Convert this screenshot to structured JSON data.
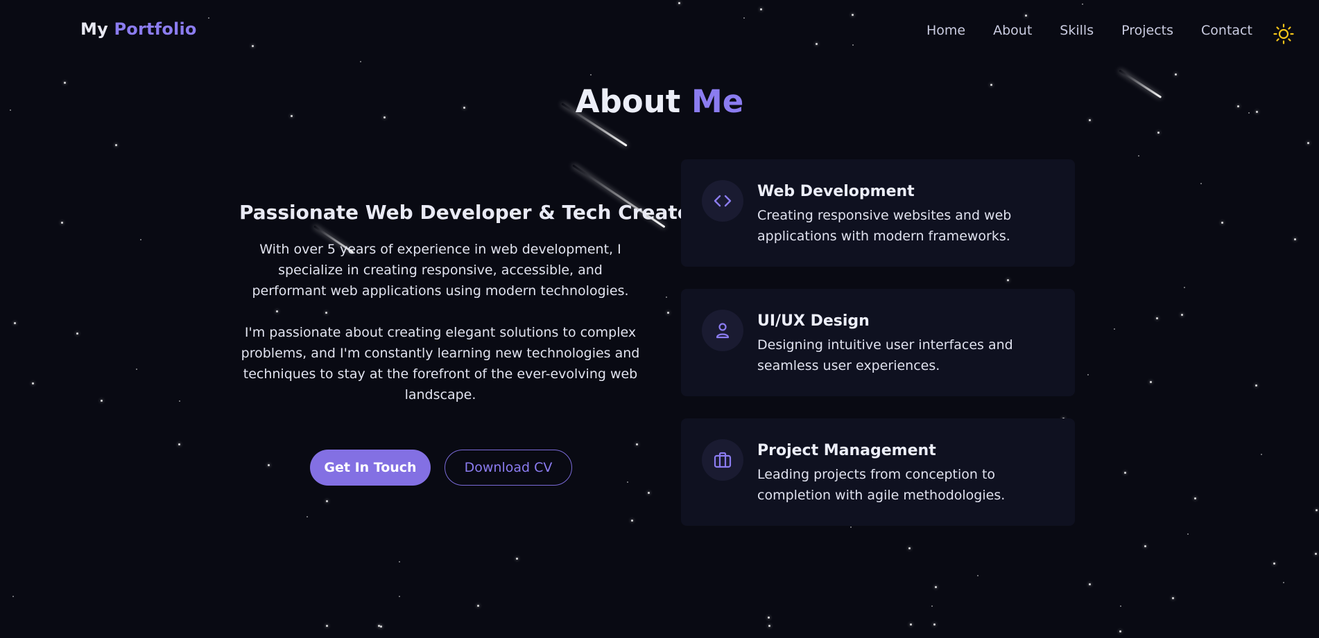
{
  "brand": {
    "first": "My",
    "second": "Portfolio"
  },
  "nav": {
    "items": [
      "Home",
      "About",
      "Skills",
      "Projects",
      "Contact"
    ],
    "theme_icon": "sun-icon"
  },
  "section": {
    "title_first": "About",
    "title_second": "Me"
  },
  "intro": {
    "heading": "Passionate Web Developer & Tech Creator",
    "paragraph_1": "With over 5 years of experience in web development, I specialize in creating responsive, accessible, and performant web applications using modern technologies.",
    "paragraph_2": "I'm passionate about creating elegant solutions to complex problems, and I'm constantly learning new technologies and techniques to stay at the forefront of the ever-evolving web landscape."
  },
  "buttons": {
    "primary": "Get In Touch",
    "secondary": "Download CV"
  },
  "cards": [
    {
      "title": "Web Development",
      "description": "Creating responsive websites and web applications with modern frameworks.",
      "icon": "code-icon"
    },
    {
      "title": "UI/UX Design",
      "description": "Designing intuitive user interfaces and seamless user experiences.",
      "icon": "user-icon"
    },
    {
      "title": "Project Management",
      "description": "Leading projects from conception to completion with agile methodologies.",
      "icon": "briefcase-icon"
    }
  ],
  "colors": {
    "background": "#090a13",
    "accent": "#8b7cf0",
    "card": "#0f1120",
    "sun": "#f5c518"
  }
}
